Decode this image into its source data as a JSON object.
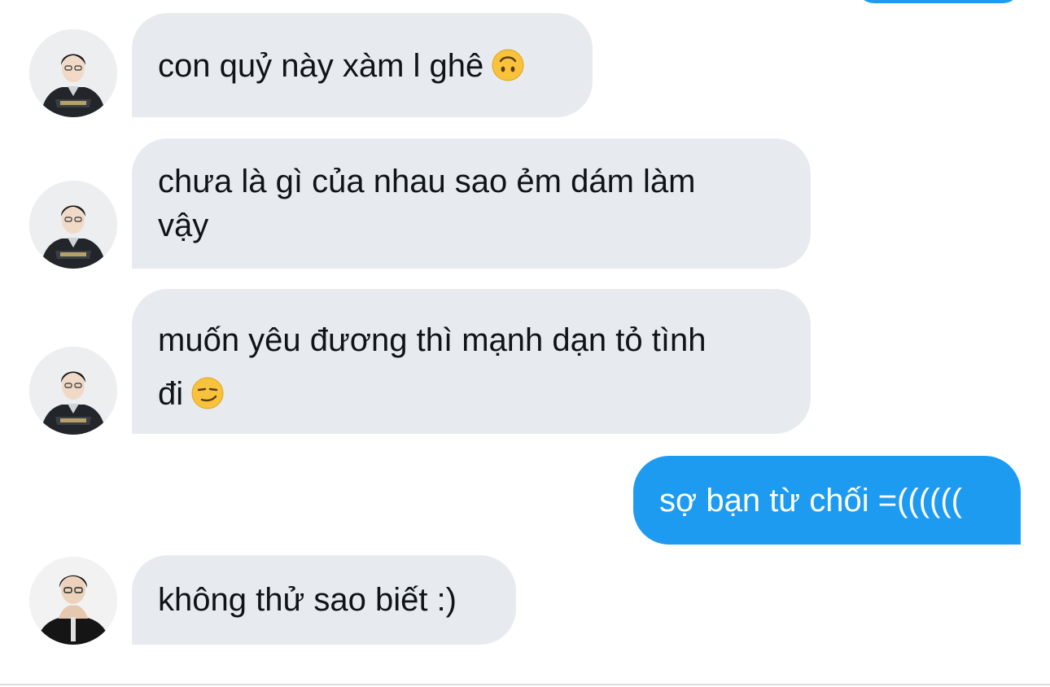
{
  "colors": {
    "incoming_bubble": "#e7ebef",
    "outgoing_bubble": "#1d9bf0",
    "incoming_text": "#0f1419",
    "outgoing_text": "#ffffff"
  },
  "messages": [
    {
      "direction": "incoming",
      "avatar": "avatar-jacket-icon",
      "lines": [
        "con quỷ này xàm l ghê"
      ],
      "emoji": "upside-down-face-emoji"
    },
    {
      "direction": "incoming",
      "avatar": "avatar-jacket-icon",
      "lines": [
        "chưa là gì của nhau sao ẻm dám làm",
        "vậy"
      ]
    },
    {
      "direction": "incoming",
      "avatar": "avatar-jacket-icon",
      "lines": [
        "muốn yêu đương thì mạnh dạn tỏ tình",
        "đi"
      ],
      "emoji": "smirking-face-emoji"
    },
    {
      "direction": "outgoing",
      "lines": [
        "sợ bạn từ chối =(((((("
      ]
    },
    {
      "direction": "incoming",
      "avatar": "avatar-tshirt-icon",
      "lines": [
        "không thử sao biết :)"
      ]
    }
  ]
}
